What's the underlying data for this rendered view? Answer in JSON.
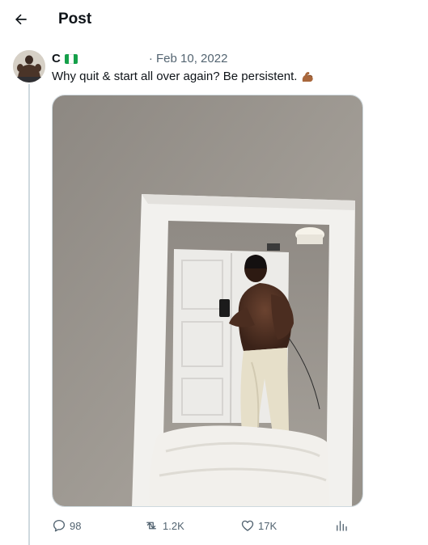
{
  "header": {
    "title": "Post"
  },
  "post": {
    "author_name": "C",
    "date": "· Feb 10, 2022",
    "text": "Why quit & start all over again? Be persistent.",
    "emoji": "flexed-biceps-icon"
  },
  "actions": {
    "replies": "98",
    "reposts": "1.2K",
    "likes": "17K"
  },
  "icons": [
    "back-arrow-icon",
    "nigeria-flag-icon",
    "reply-icon",
    "repost-icon",
    "like-icon",
    "views-icon"
  ],
  "colors": {
    "text": "#0f1419",
    "secondary": "#536471",
    "border": "#cfd9de",
    "flag_green": "#15a04a"
  }
}
